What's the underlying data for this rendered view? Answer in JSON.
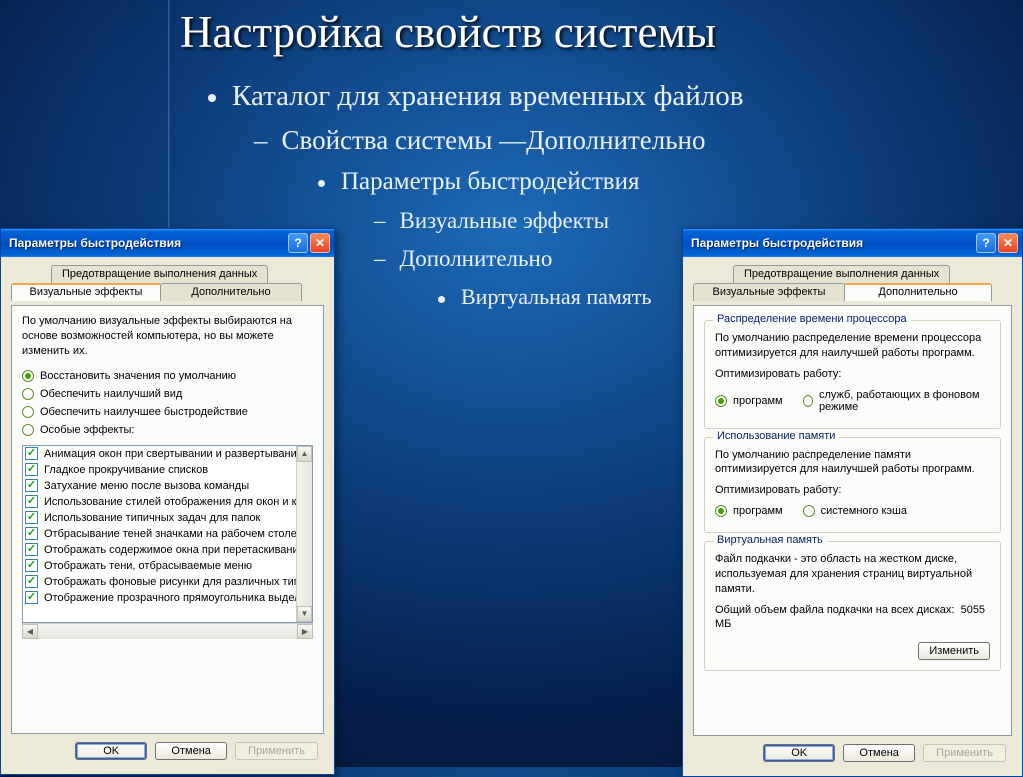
{
  "slide": {
    "title": "Настройка свойств системы",
    "items": {
      "l1": "Каталог для хранения временных файлов",
      "l2": "Свойства системы —Дополнительно",
      "l3": "Параметры быстродействия",
      "l4a": "Визуальные эффекты",
      "l4b": "Дополнительно",
      "l5": "Виртуальная память"
    }
  },
  "dlg_left": {
    "title": "Параметры быстродействия",
    "tabs": {
      "dep": "Предотвращение выполнения данных",
      "vis": "Визуальные эффекты",
      "adv": "Дополнительно"
    },
    "desc": "По умолчанию визуальные эффекты выбираются на основе возможностей компьютера, но вы можете изменить их.",
    "radios": {
      "r1": "Восстановить значения по умолчанию",
      "r2": "Обеспечить наилучший вид",
      "r3": "Обеспечить наилучшее быстродействие",
      "r4": "Особые эффекты:"
    },
    "list": [
      "Анимация окон при свертывании и развертывании",
      "Гладкое прокручивание списков",
      "Затухание меню после вызова команды",
      "Использование стилей отображения для окон и кнопо",
      "Использование типичных задач для папок",
      "Отбрасывание теней значками на рабочем столе",
      "Отображать содержимое окна при перетаскивании",
      "Отображать тени, отбрасываемые меню",
      "Отображать фоновые рисунки для различных типов п",
      "Отображение прозрачного прямоугольника выделени"
    ]
  },
  "dlg_right": {
    "title": "Параметры быстродействия",
    "tabs": {
      "dep": "Предотвращение выполнения данных",
      "vis": "Визуальные эффекты",
      "adv": "Дополнительно"
    },
    "cpu": {
      "legend": "Распределение времени процессора",
      "desc": "По умолчанию распределение времени процессора оптимизируется для наилучшей работы программ.",
      "label": "Оптимизировать работу:",
      "opt1": "программ",
      "opt2": "служб, работающих в фоновом режиме"
    },
    "mem": {
      "legend": "Использование памяти",
      "desc": "По умолчанию распределение памяти оптимизируется для наилучшей работы программ.",
      "label": "Оптимизировать работу:",
      "opt1": "программ",
      "opt2": "системного кэша"
    },
    "vm": {
      "legend": "Виртуальная память",
      "desc": "Файл подкачки - это область на жестком диске, используемая для хранения страниц виртуальной памяти.",
      "total_label": "Общий объем файла подкачки на всех дисках:",
      "total_value": "5055 МБ",
      "change": "Изменить"
    }
  },
  "buttons": {
    "ok": "OK",
    "cancel": "Отмена",
    "apply": "Применить"
  }
}
